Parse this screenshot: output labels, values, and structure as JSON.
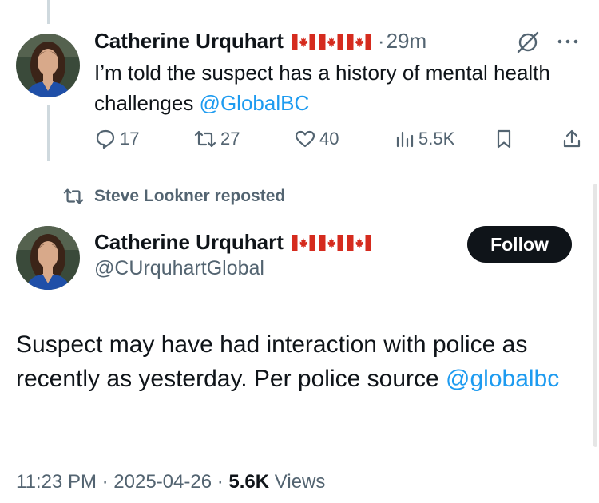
{
  "top_tweet": {
    "author_name": "Catherine Urquhart",
    "flags": [
      "canada-flag",
      "canada-flag",
      "canada-flag"
    ],
    "time_separator": "·",
    "time": "29m",
    "text_before_mention": "I’m told the suspect has a history of mental health challenges ",
    "mention": "@GlobalBC",
    "actions": {
      "replies": "17",
      "reposts": "27",
      "likes": "40",
      "views": "5.5K"
    }
  },
  "repost_banner": {
    "text": "Steve Lookner reposted"
  },
  "main_tweet": {
    "author_name": "Catherine Urquhart",
    "flags": [
      "canada-flag",
      "canada-flag",
      "canada-flag"
    ],
    "handle": "@CUrquhartGlobal",
    "follow_label": "Follow",
    "text_before_mention": "Suspect may have had interaction with police as recently as yesterday. Per police source ",
    "mention": "@globalbc",
    "time": "11:23 PM",
    "separator": "·",
    "date": "2025-04-26",
    "views_count": "5.6K",
    "views_label": "Views"
  },
  "colors": {
    "text": "#0f1419",
    "secondary": "#536471",
    "link": "#1d9bf0",
    "flag_red": "#d52b1e"
  }
}
